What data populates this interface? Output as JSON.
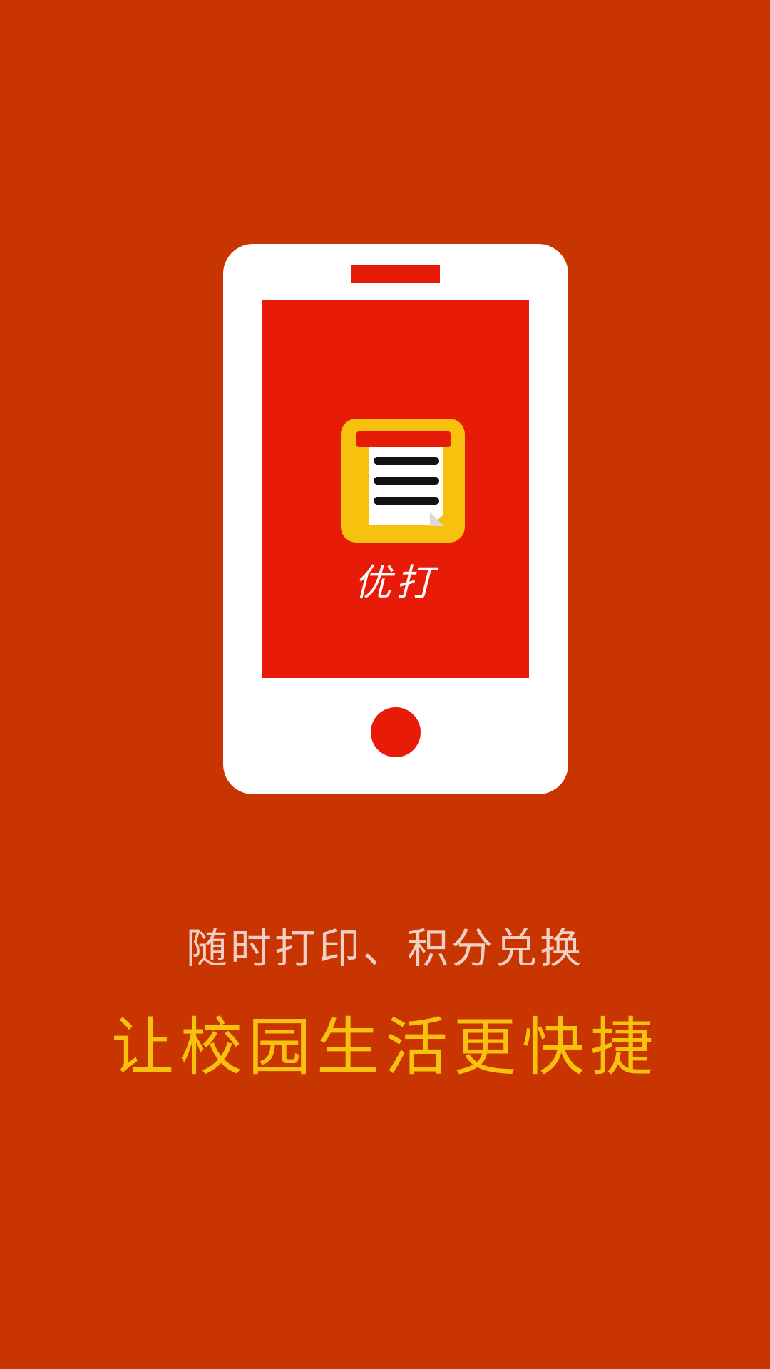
{
  "app": {
    "name": "优打"
  },
  "colors": {
    "background": "#C93500",
    "screen_red": "#E81A08",
    "icon_yellow": "#F7C20E",
    "phone_white": "#FFFFFF",
    "subtitle_color": "#F2CFC5",
    "slogan_color": "#F7C20E"
  },
  "illustration": {
    "device": "phone-illustration",
    "icon": "document-icon"
  },
  "text": {
    "subtitle": "随时打印、积分兑换",
    "slogan": "让校园生活更快捷"
  }
}
